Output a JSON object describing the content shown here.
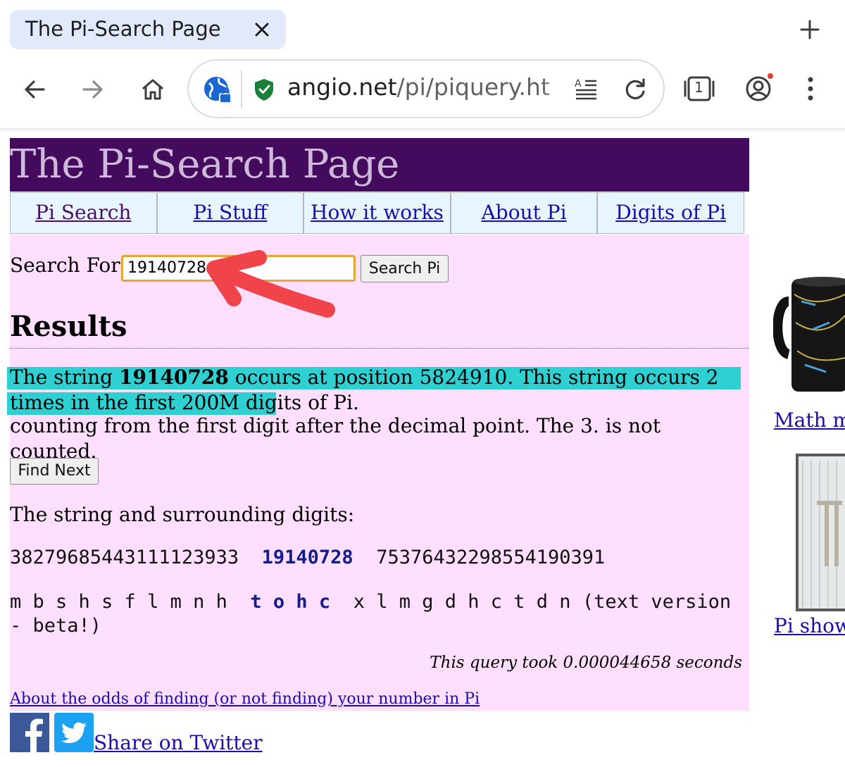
{
  "browser": {
    "tab_title": "The Pi-Search Page",
    "url_host": "angio.net",
    "url_path": "/pi/piquery.ht",
    "tab_count": "1"
  },
  "page": {
    "banner_title": "The Pi-Search Page",
    "nav": [
      "Pi Search",
      "Pi Stuff",
      "How it works",
      "About Pi",
      "Digits of Pi"
    ],
    "search_label": "Search For:",
    "search_value": "19140728",
    "search_button": "Search Pi",
    "results_heading": "Results",
    "result_line": {
      "prefix": "The string ",
      "string": "19140728",
      "middle": " occurs at position 5824910. This string occurs 2 times in the first 200M digits of Pi."
    },
    "result_note": "counting from the first digit after the decimal point. The 3. is not counted.",
    "find_next_button": "Find Next",
    "surrounding_label": "The string and surrounding digits:",
    "digits_before": "38279685443111123933",
    "digits_hit": "19140728",
    "digits_after": "75376432298554190391",
    "letters_before": "m b s h s f l m n h",
    "letters_hit": "t o h c",
    "letters_after": "x l m g d h c t d n",
    "letters_suffix": "(text version - beta!)",
    "timing": "This query took 0.000044658 seconds",
    "odds_link": "About the odds of finding (or not finding) your number in Pi",
    "share_link": "Share on Twitter"
  },
  "sidebar": {
    "math_link": "Math m",
    "show_link": "Pi show"
  },
  "colors": {
    "banner_bg": "#430a5d",
    "nav_bg": "#e7f6fe",
    "content_bg": "#ffdffd",
    "highlight": "#2ed0d2",
    "hit_digits": "#141d8c",
    "link": "#1a0dab",
    "annotation_arrow": "#f0444a"
  }
}
